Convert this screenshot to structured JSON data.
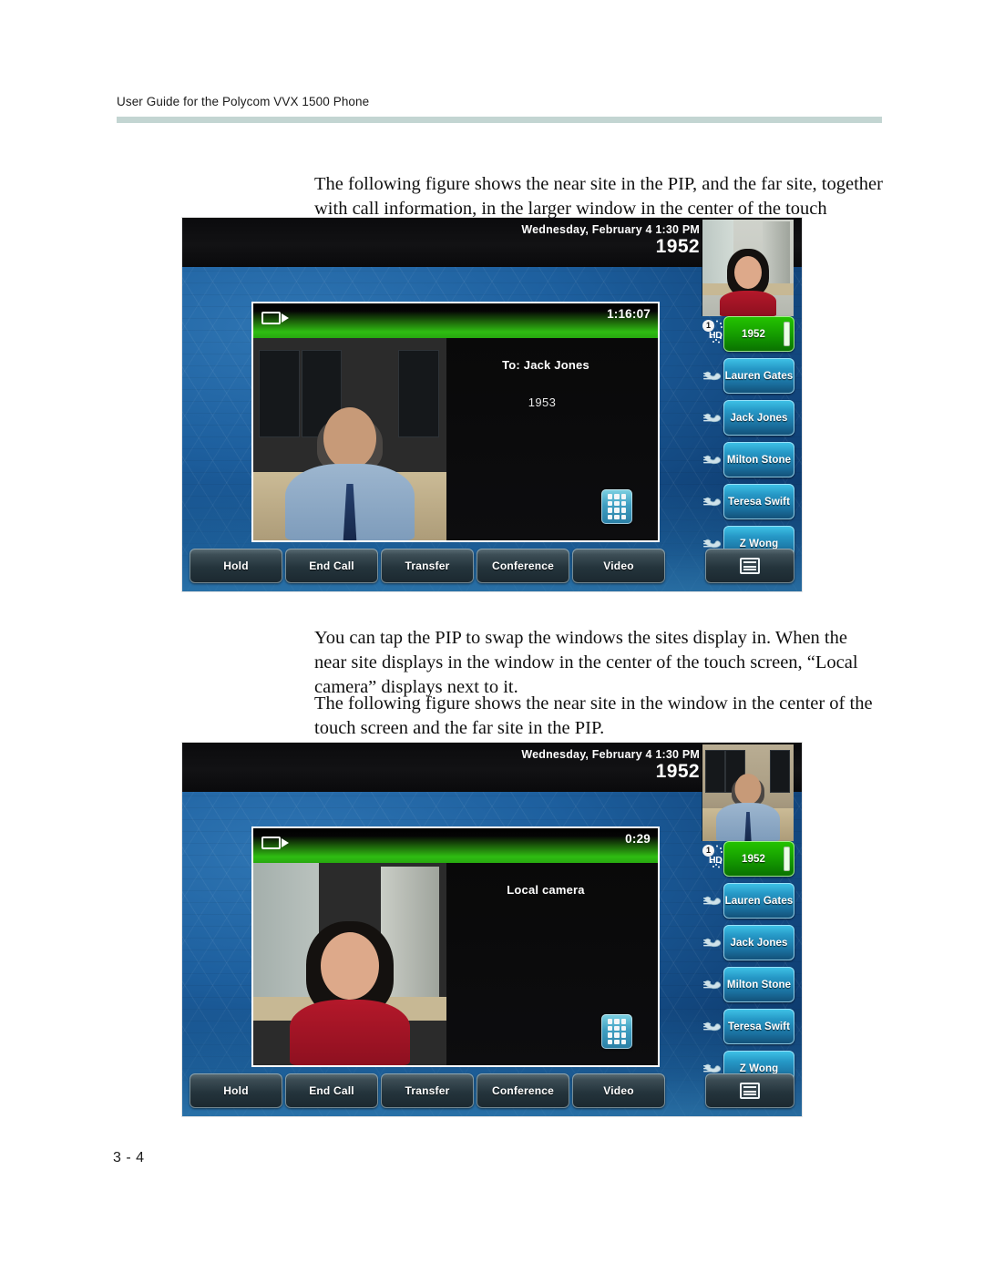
{
  "document": {
    "running_head": "User Guide for the Polycom VVX 1500 Phone",
    "page_number": "3 - 4",
    "rule_color": "#c3d5d2"
  },
  "paragraphs": {
    "p1": "The following figure shows the near site in the PIP, and the far site, together with call information, in the larger window in the center of the touch screen.",
    "p2": "You can tap the PIP to swap the windows the sites display in. When the near site displays in the window in the center of the touch screen, “Local camera” displays next to it.",
    "p3": "The following figure shows the near site in the window in the center of the touch screen and the far site in the PIP."
  },
  "figure1": {
    "caption_role": "near-site-in-pip",
    "status": {
      "datetime": "Wednesday, February 4  1:30 PM",
      "extension": "1952"
    },
    "pip": {
      "subject": "near-site-woman",
      "scene": "office-lobby"
    },
    "video": {
      "camera_icon": "video-camera-icon",
      "timer": "1:16:07",
      "feed_subject": "far-site-man",
      "info_to": "To: Jack Jones",
      "info_number": "1953",
      "dialpad_icon": "dialpad-icon"
    },
    "linekeys": [
      {
        "label": "1952",
        "state": "active",
        "icon": "hd-line-badge",
        "line_number": "1",
        "hd_label": "HD"
      },
      {
        "label": "Lauren Gates",
        "state": "idle",
        "icon": "handset-icon"
      },
      {
        "label": "Jack Jones",
        "state": "idle",
        "icon": "handset-icon"
      },
      {
        "label": "Milton Stone",
        "state": "idle",
        "icon": "handset-icon"
      },
      {
        "label": "Teresa Swift",
        "state": "idle",
        "icon": "handset-icon"
      },
      {
        "label": "Z Wong",
        "state": "idle",
        "icon": "handset-icon"
      }
    ],
    "softkeys": [
      "Hold",
      "End Call",
      "Transfer",
      "Conference",
      "Video"
    ],
    "menu_key_icon": "menu-icon"
  },
  "figure2": {
    "caption_role": "near-site-in-main-window",
    "status": {
      "datetime": "Wednesday, February 4  1:30 PM",
      "extension": "1952"
    },
    "pip": {
      "subject": "far-site-man",
      "scene": "office-desk"
    },
    "video": {
      "camera_icon": "video-camera-icon",
      "timer": "0:29",
      "feed_subject": "near-site-woman",
      "info_to": "Local camera",
      "info_number": "",
      "dialpad_icon": "dialpad-icon"
    },
    "linekeys": [
      {
        "label": "1952",
        "state": "active",
        "icon": "hd-line-badge",
        "line_number": "1",
        "hd_label": "HD"
      },
      {
        "label": "Lauren Gates",
        "state": "idle",
        "icon": "handset-icon"
      },
      {
        "label": "Jack Jones",
        "state": "idle",
        "icon": "handset-icon"
      },
      {
        "label": "Milton Stone",
        "state": "idle",
        "icon": "handset-icon"
      },
      {
        "label": "Teresa Swift",
        "state": "idle",
        "icon": "handset-icon"
      },
      {
        "label": "Z Wong",
        "state": "idle",
        "icon": "handset-icon"
      }
    ],
    "softkeys": [
      "Hold",
      "End Call",
      "Transfer",
      "Conference",
      "Video"
    ],
    "menu_key_icon": "menu-icon"
  },
  "colors": {
    "active_line_green": "#19a800",
    "idle_line_blue": "#2698c6",
    "wallpaper_blue": "#1d5f9e",
    "softkey_dark": "#24343c"
  }
}
